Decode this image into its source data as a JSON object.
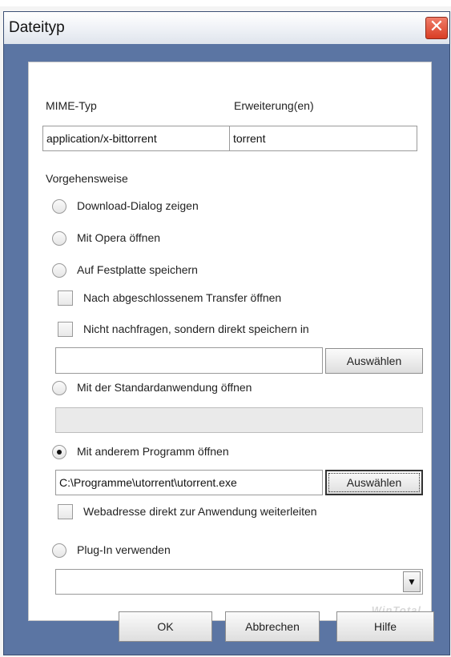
{
  "window": {
    "title": "Dateityp",
    "close_icon": "close-icon"
  },
  "fields": {
    "mime_label": "MIME-Typ",
    "ext_label": "Erweiterung(en)",
    "mime_value": "application/x-bittorrent",
    "ext_value": "torrent"
  },
  "action": {
    "section_label": "Vorgehensweise",
    "options": [
      {
        "label": "Download-Dialog zeigen",
        "selected": false
      },
      {
        "label": "Mit Opera öffnen",
        "selected": false
      },
      {
        "label": "Auf Festplatte speichern",
        "selected": false
      },
      {
        "label": "Mit der Standardanwendung öffnen",
        "selected": false
      },
      {
        "label": "Mit anderem Programm öffnen",
        "selected": true
      },
      {
        "label": "Plug-In verwenden",
        "selected": false
      }
    ],
    "save_open_after_label": "Nach abgeschlossenem Transfer öffnen",
    "save_no_ask_label": "Nicht nachfragen, sondern direkt speichern in",
    "save_path_value": "",
    "choose_label": "Auswählen",
    "default_app_value": "",
    "program_path_value": "C:\\Programme\\utorrent\\utorrent.exe",
    "pass_url_label": "Webadresse direkt zur Anwendung weiterleiten",
    "plugin_value": ""
  },
  "footer": {
    "ok_label": "OK",
    "cancel_label": "Abbrechen",
    "help_label": "Hilfe"
  }
}
